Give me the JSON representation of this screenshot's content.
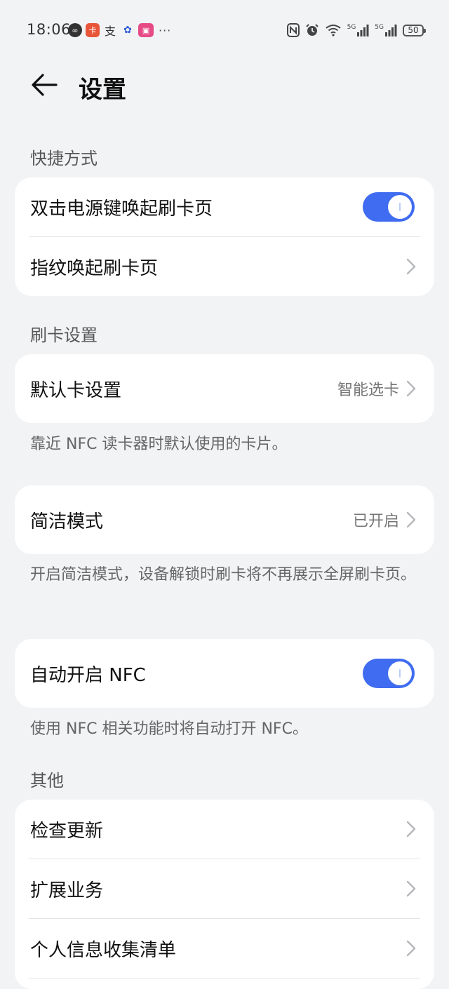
{
  "status_bar": {
    "time": "18:06",
    "network_1": "5G",
    "network_2": "5G",
    "battery": "50"
  },
  "header": {
    "title": "设置"
  },
  "sections": {
    "shortcuts": {
      "label": "快捷方式",
      "double_click_power": "双击电源键唤起刷卡页",
      "double_click_power_on": true,
      "fingerprint": "指纹唤起刷卡页"
    },
    "card_settings": {
      "label": "刷卡设置",
      "default_card": "默认卡设置",
      "default_card_value": "智能选卡",
      "default_card_note": "靠近 NFC 读卡器时默认使用的卡片。"
    },
    "simple_mode": {
      "label": "简洁模式",
      "value": "已开启",
      "note": "开启简洁模式，设备解锁时刷卡将不再展示全屏刷卡页。"
    },
    "auto_nfc": {
      "label": "自动开启 NFC",
      "enabled": true,
      "note": "使用 NFC 相关功能时将自动打开 NFC。"
    },
    "other": {
      "label": "其他",
      "items": [
        "检查更新",
        "扩展业务",
        "个人信息收集清单"
      ]
    }
  }
}
